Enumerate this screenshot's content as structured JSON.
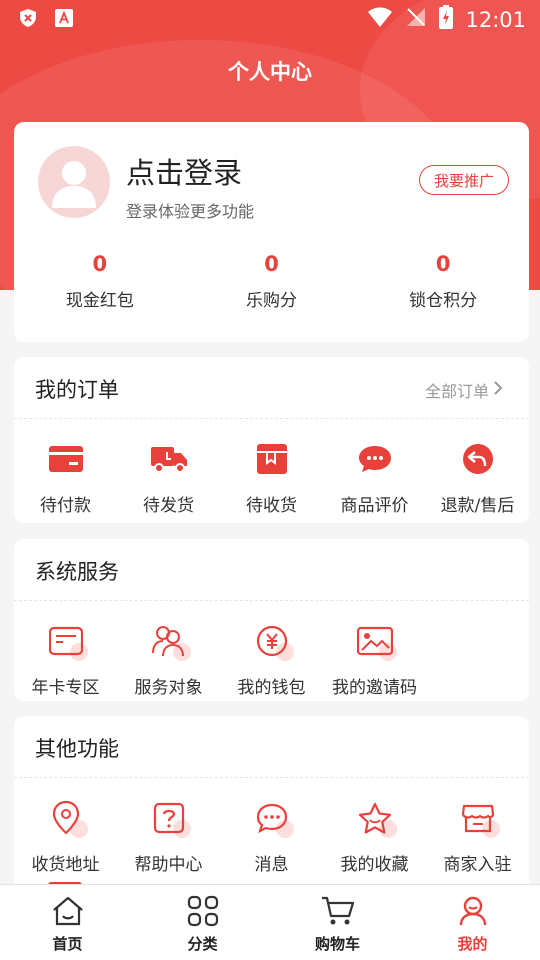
{
  "status_bar": {
    "time": "12:01"
  },
  "page_title": "个人中心",
  "profile": {
    "login_title": "点击登录",
    "login_subtitle": "登录体验更多功能",
    "promote_label": "我要推广",
    "stats": [
      {
        "value": "0",
        "label": "现金红包"
      },
      {
        "value": "0",
        "label": "乐购分"
      },
      {
        "value": "0",
        "label": "锁仓积分"
      }
    ]
  },
  "orders": {
    "title": "我的订单",
    "all_label": "全部订单",
    "items": [
      {
        "label": "待付款",
        "icon": "card-icon"
      },
      {
        "label": "待发货",
        "icon": "truck-icon"
      },
      {
        "label": "待收货",
        "icon": "package-icon"
      },
      {
        "label": "商品评价",
        "icon": "chat-bubble-icon"
      },
      {
        "label": "退款/售后",
        "icon": "return-icon"
      }
    ]
  },
  "services": {
    "title": "系统服务",
    "items": [
      {
        "label": "年卡专区",
        "icon": "year-card-icon"
      },
      {
        "label": "服务对象",
        "icon": "users-icon"
      },
      {
        "label": "我的钱包",
        "icon": "yen-coin-icon"
      },
      {
        "label": "我的邀请码",
        "icon": "picture-icon"
      }
    ]
  },
  "others": {
    "title": "其他功能",
    "items": [
      {
        "label": "收货地址",
        "icon": "location-pin-icon"
      },
      {
        "label": "帮助中心",
        "icon": "help-icon"
      },
      {
        "label": "消息",
        "icon": "message-icon"
      },
      {
        "label": "我的收藏",
        "icon": "star-icon"
      },
      {
        "label": "商家入驻",
        "icon": "store-icon"
      }
    ]
  },
  "tabbar": [
    {
      "label": "首页",
      "icon": "home-icon",
      "active": false
    },
    {
      "label": "分类",
      "icon": "grid-icon",
      "active": false
    },
    {
      "label": "购物车",
      "icon": "cart-icon",
      "active": false
    },
    {
      "label": "我的",
      "icon": "user-icon",
      "active": true
    }
  ],
  "colors": {
    "accent": "#e8413c",
    "hero": "#ee4a44",
    "background": "#f5f5f5"
  }
}
